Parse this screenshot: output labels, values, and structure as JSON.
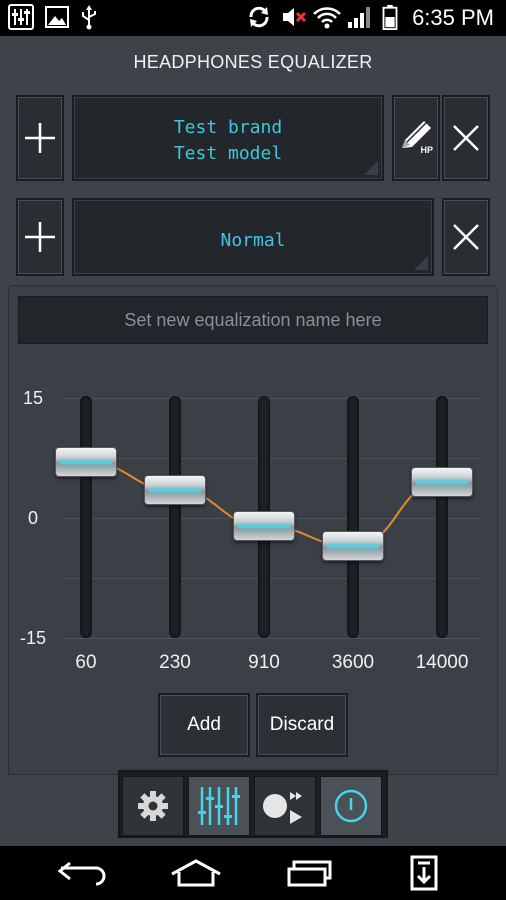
{
  "status_bar": {
    "time": "6:35 PM",
    "icons": [
      "equalizer-notification-icon",
      "image-icon",
      "usb-icon",
      "sync-icon",
      "mute-icon",
      "wifi-icon",
      "signal-icon",
      "battery-icon"
    ]
  },
  "header": {
    "title": "HEADPHONES EQUALIZER"
  },
  "headphone_selector": {
    "brand": "Test brand",
    "model": "Test model",
    "edit_badge": "HP"
  },
  "preset_selector": {
    "preset": "Normal"
  },
  "equalizer": {
    "name_placeholder": "Set new equalization name here",
    "y_axis": {
      "max_label": "15",
      "mid_label": "0",
      "min_label": "-15",
      "range": [
        -15,
        15
      ]
    },
    "bands": [
      {
        "freq": "60",
        "gain": 7
      },
      {
        "freq": "230",
        "gain": 3.5
      },
      {
        "freq": "910",
        "gain": -1
      },
      {
        "freq": "3600",
        "gain": -3.5
      },
      {
        "freq": "14000",
        "gain": 4.5
      }
    ],
    "curve_color": "#e8892b",
    "accent_color": "#45d4ea",
    "add_label": "Add",
    "discard_label": "Discard"
  },
  "toolbar": {
    "items": [
      "gear-icon",
      "sliders-icon",
      "record-playback-icon",
      "power-icon"
    ],
    "active_index": 1
  },
  "nav_bar": {
    "items": [
      "back-icon",
      "home-icon",
      "recents-icon",
      "download-icon"
    ]
  }
}
